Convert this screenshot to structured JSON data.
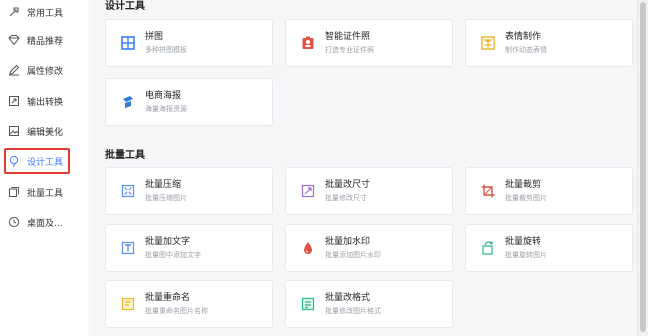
{
  "sidebar": {
    "items": [
      {
        "label": "常用工具",
        "icon": "toolbox-icon"
      },
      {
        "label": "精品推荐",
        "icon": "diamond-icon"
      },
      {
        "label": "属性修改",
        "icon": "pencil-icon"
      },
      {
        "label": "输出转换",
        "icon": "export-icon"
      },
      {
        "label": "编辑美化",
        "icon": "image-edit-icon"
      },
      {
        "label": "设计工具",
        "icon": "bulb-icon"
      },
      {
        "label": "批量工具",
        "icon": "batch-icon"
      },
      {
        "label": "桌面及...",
        "icon": "clock-icon"
      }
    ],
    "active_index": 5,
    "highlight_color": "#e03c2f",
    "active_color": "#3b7cff"
  },
  "design_section": {
    "title": "设计工具",
    "cards": [
      {
        "name": "拼图",
        "desc": "多种拼图模板",
        "icon": "collage-icon",
        "color": "#3b7cff"
      },
      {
        "name": "智能证件照",
        "desc": "打造专业证件照",
        "icon": "id-photo-icon",
        "color": "#e0524a"
      },
      {
        "name": "表情制作",
        "desc": "制作动态表情",
        "icon": "emoji-icon",
        "color": "#f0b429"
      },
      {
        "name": "电商海报",
        "desc": "海量海报资源",
        "icon": "poster-icon",
        "color": "#2e7bd6"
      }
    ]
  },
  "batch_section": {
    "title": "批量工具",
    "cards": [
      {
        "name": "批量压缩",
        "desc": "批量压缩图片",
        "icon": "compress-icon",
        "color": "#5b8def"
      },
      {
        "name": "批量改尺寸",
        "desc": "批量修改尺寸",
        "icon": "resize-icon",
        "color": "#9a6fd8"
      },
      {
        "name": "批量裁剪",
        "desc": "批量裁剪图片",
        "icon": "crop-icon",
        "color": "#e0524a"
      },
      {
        "name": "批量加文字",
        "desc": "批量图中添加文字",
        "icon": "add-text-icon",
        "color": "#5b8def"
      },
      {
        "name": "批量加水印",
        "desc": "批量添加图片水印",
        "icon": "watermark-icon",
        "color": "#e0524a"
      },
      {
        "name": "批量旋转",
        "desc": "批量旋转图片",
        "icon": "rotate-icon",
        "color": "#2fb68a"
      },
      {
        "name": "批量重命名",
        "desc": "批量重命名图片名称",
        "icon": "rename-icon",
        "color": "#f0b429"
      },
      {
        "name": "批量改格式",
        "desc": "批量修改图片格式",
        "icon": "format-icon",
        "color": "#2fb68a"
      }
    ]
  }
}
